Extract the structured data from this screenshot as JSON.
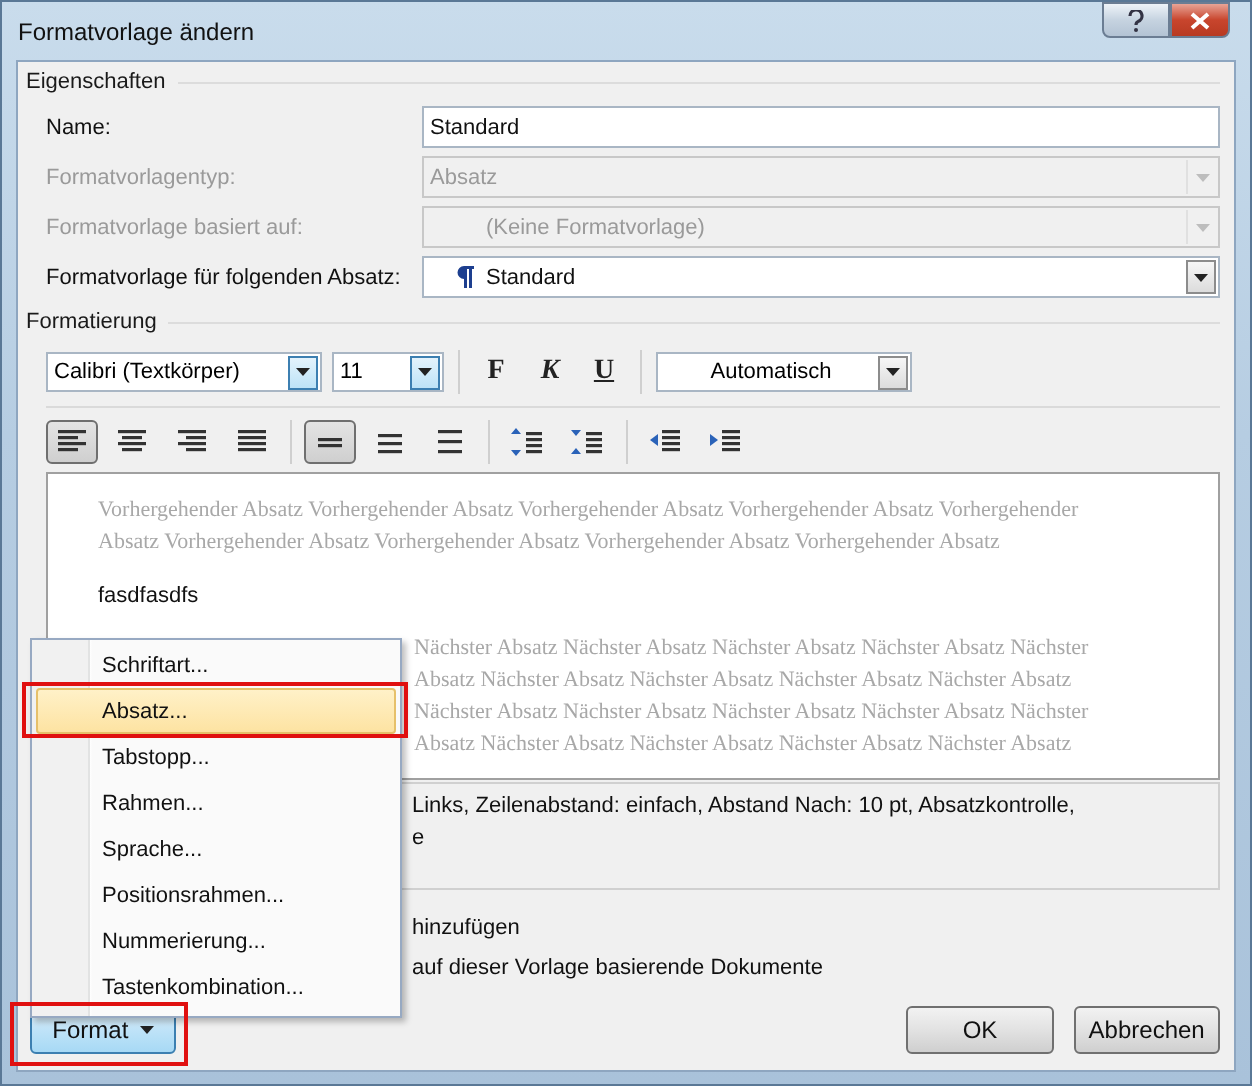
{
  "window": {
    "title": "Formatvorlage ändern"
  },
  "properties": {
    "heading": "Eigenschaften",
    "rows": [
      {
        "label": "Name:",
        "kind": "text",
        "value": "Standard",
        "disabled": false
      },
      {
        "label": "Formatvorlagentyp:",
        "kind": "combo",
        "value": "Absatz",
        "disabled": true
      },
      {
        "label": "Formatvorlage basiert auf:",
        "kind": "style-combo",
        "value": "(Keine Formatvorlage)",
        "paragraph_icon": false,
        "disabled": true
      },
      {
        "label": "Formatvorlage für folgenden Absatz:",
        "kind": "style-combo",
        "value": "Standard",
        "paragraph_icon": true,
        "disabled": false
      }
    ]
  },
  "formatting": {
    "heading": "Formatierung",
    "font": "Calibri (Textkörper)",
    "size": "11",
    "text_color_setting": "Automatisch",
    "style_buttons": [
      {
        "label": "F",
        "kind": "bold",
        "selected": false
      },
      {
        "label": "K",
        "kind": "italic",
        "selected": false
      },
      {
        "label": "U",
        "kind": "underline",
        "selected": false
      }
    ],
    "tool_groups": [
      {
        "buttons": [
          {
            "kind": "align-left",
            "selected": true
          },
          {
            "kind": "align-center",
            "selected": false
          },
          {
            "kind": "align-right",
            "selected": false
          },
          {
            "kind": "justify",
            "selected": false
          }
        ]
      },
      {
        "buttons": [
          {
            "kind": "spacing-single",
            "selected": true
          },
          {
            "kind": "spacing-one-half",
            "selected": false
          },
          {
            "kind": "spacing-double",
            "selected": false
          }
        ]
      },
      {
        "buttons": [
          {
            "kind": "space-increase"
          },
          {
            "kind": "space-decrease"
          }
        ]
      },
      {
        "buttons": [
          {
            "kind": "indent-decrease"
          },
          {
            "kind": "indent-increase"
          }
        ]
      }
    ]
  },
  "preview": {
    "previous": [
      "Vorhergehender Absatz Vorhergehender Absatz Vorhergehender Absatz Vorhergehender Absatz Vorhergehender",
      "Absatz Vorhergehender Absatz Vorhergehender Absatz Vorhergehender Absatz Vorhergehender Absatz"
    ],
    "sample": "fasdfasdfs",
    "next": [
      "Nächster Absatz Nächster Absatz Nächster Absatz Nächster Absatz Nächster",
      "Absatz Nächster Absatz Nächster Absatz Nächster Absatz Nächster Absatz",
      "Nächster Absatz Nächster Absatz Nächster Absatz Nächster Absatz Nächster",
      "Absatz Nächster Absatz Nächster Absatz Nächster Absatz Nächster Absatz"
    ]
  },
  "description": [
    "Links, Zeilenabstand:  einfach, Abstand Nach:  10 pt, Absatzkontrolle,",
    "e"
  ],
  "options": [
    "hinzufügen",
    "auf dieser Vorlage basierende Dokumente"
  ],
  "menu": {
    "items": [
      {
        "label": "Schriftart...",
        "selected": false,
        "marked": false
      },
      {
        "label": "Absatz...",
        "selected": true,
        "marked": true
      },
      {
        "label": "Tabstopp...",
        "selected": false,
        "marked": false
      },
      {
        "label": "Rahmen...",
        "selected": false,
        "marked": false
      },
      {
        "label": "Sprache...",
        "selected": false,
        "marked": false
      },
      {
        "label": "Positionsrahmen...",
        "selected": false,
        "marked": false
      },
      {
        "label": "Nummerierung...",
        "selected": false,
        "marked": false
      },
      {
        "label": "Tastenkombination...",
        "selected": false,
        "marked": false
      }
    ]
  },
  "buttons": {
    "format": {
      "label": "Format",
      "marked": true
    },
    "ok": "OK",
    "cancel": "Abbrechen"
  }
}
